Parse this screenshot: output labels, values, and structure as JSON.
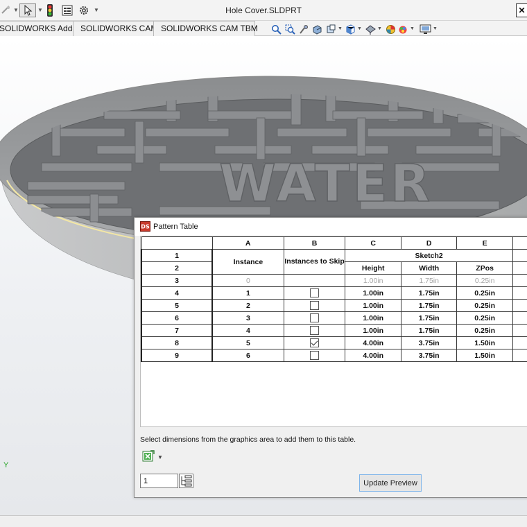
{
  "window": {
    "title": "Hole Cover.SLDPRT",
    "close_glyph": "✕"
  },
  "tabs": [
    {
      "label": "SOLIDWORKS Add-Ins"
    },
    {
      "label": "SOLIDWORKS CAM"
    },
    {
      "label": "SOLIDWORKS CAM TBM"
    }
  ],
  "model": {
    "embossed_text": "WATER"
  },
  "graphics": {
    "axis_label": "Y"
  },
  "dialog": {
    "title": "Pattern Table",
    "hint": "Select dimensions from the graphics area to add them to this table.",
    "instance_input_value": "1",
    "update_button_label": "Update Preview"
  },
  "table": {
    "col_letters": [
      "A",
      "B",
      "C",
      "D",
      "E"
    ],
    "row_numbers": [
      "1",
      "2",
      "3",
      "4",
      "5",
      "6",
      "7",
      "8",
      "9"
    ],
    "instance_header": "Instance",
    "skip_header": "Instances to Skip",
    "group_header": "Sketch2",
    "dim_headers": [
      "Height",
      "Width",
      "ZPos"
    ],
    "rows": [
      {
        "instance": "0",
        "skip": null,
        "height": "1.00in",
        "width": "1.75in",
        "zpos": "0.25in",
        "seed": true
      },
      {
        "instance": "1",
        "skip": false,
        "height": "1.00in",
        "width": "1.75in",
        "zpos": "0.25in"
      },
      {
        "instance": "2",
        "skip": false,
        "height": "1.00in",
        "width": "1.75in",
        "zpos": "0.25in"
      },
      {
        "instance": "3",
        "skip": false,
        "height": "1.00in",
        "width": "1.75in",
        "zpos": "0.25in"
      },
      {
        "instance": "4",
        "skip": false,
        "height": "1.00in",
        "width": "1.75in",
        "zpos": "0.25in"
      },
      {
        "instance": "5",
        "skip": true,
        "height": "4.00in",
        "width": "3.75in",
        "zpos": "1.50in"
      },
      {
        "instance": "6",
        "skip": false,
        "height": "4.00in",
        "width": "3.75in",
        "zpos": "1.50in"
      }
    ]
  },
  "colors": {
    "model_face": "#6e7073",
    "model_rim": "#b9bbbc",
    "dialog_bg": "#f0f0f0",
    "button_border": "#7eb4ea"
  }
}
